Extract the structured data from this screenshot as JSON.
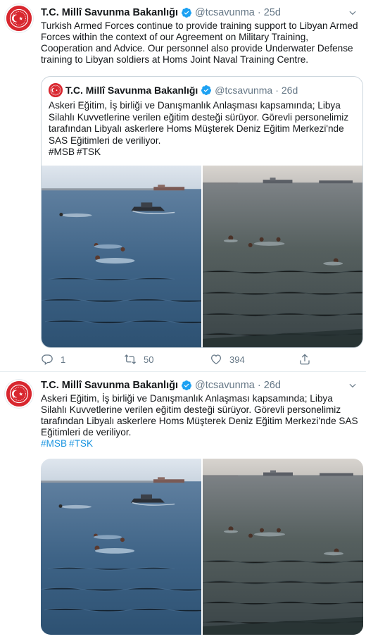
{
  "tweets": [
    {
      "author": {
        "display_name": "T.C. Millî Savunma Bakanlığı",
        "handle": "@tcsavunma",
        "verified": true
      },
      "separator": "·",
      "time": "25d",
      "text": "Turkish Armed Forces continue to provide training support to Libyan Armed Forces within the context of our Agreement on Military Training, Cooperation and Advice. Our personnel also provide Underwater Defense training to Libyan soldiers at Homs Joint Naval Training Centre.",
      "quoted": {
        "author": {
          "display_name": "T.C. Millî Savunma Bakanlığı",
          "handle": "@tcsavunma",
          "verified": true
        },
        "separator": "·",
        "time": "26d",
        "text": "Askeri Eğitim, İş birliği ve Danışmanlık Anlaşması kapsamında; Libya Silahlı Kuvvetlerine verilen eğitim desteği sürüyor. Görevli personelimiz tarafından Libyalı askerlere Homs Müşterek Deniz Eğitim Merkezi'nde SAS Eğitimleri de veriliyor.",
        "hashtags": [
          "#MSB",
          "#TSK"
        ]
      },
      "actions": {
        "replies": "1",
        "retweets": "50",
        "likes": "394"
      }
    },
    {
      "author": {
        "display_name": "T.C. Millî Savunma Bakanlığı",
        "handle": "@tcsavunma",
        "verified": true
      },
      "separator": "·",
      "time": "26d",
      "text": "Askeri Eğitim, İş birliği ve Danışmanlık Anlaşması kapsamında; Libya Silahlı Kuvvetlerine verilen eğitim desteği sürüyor. Görevli personelimiz tarafından Libyalı askerlere Homs Müşterek Deniz Eğitim Merkezi'nde SAS Eğitimleri de veriliyor.",
      "hashtags": [
        "#MSB",
        "#TSK"
      ]
    }
  ],
  "colors": {
    "link": "#1b95e0",
    "verified": "#1da1f2",
    "brand_red": "#d8272f",
    "muted": "#657786",
    "border": "#e6ecf0"
  },
  "icons": {
    "reply": "reply-icon",
    "retweet": "retweet-icon",
    "like": "heart-icon",
    "share": "share-icon",
    "verified": "verified-badge-icon",
    "menu": "chevron-down-icon",
    "avatar": "ministry-emblem-logo"
  }
}
